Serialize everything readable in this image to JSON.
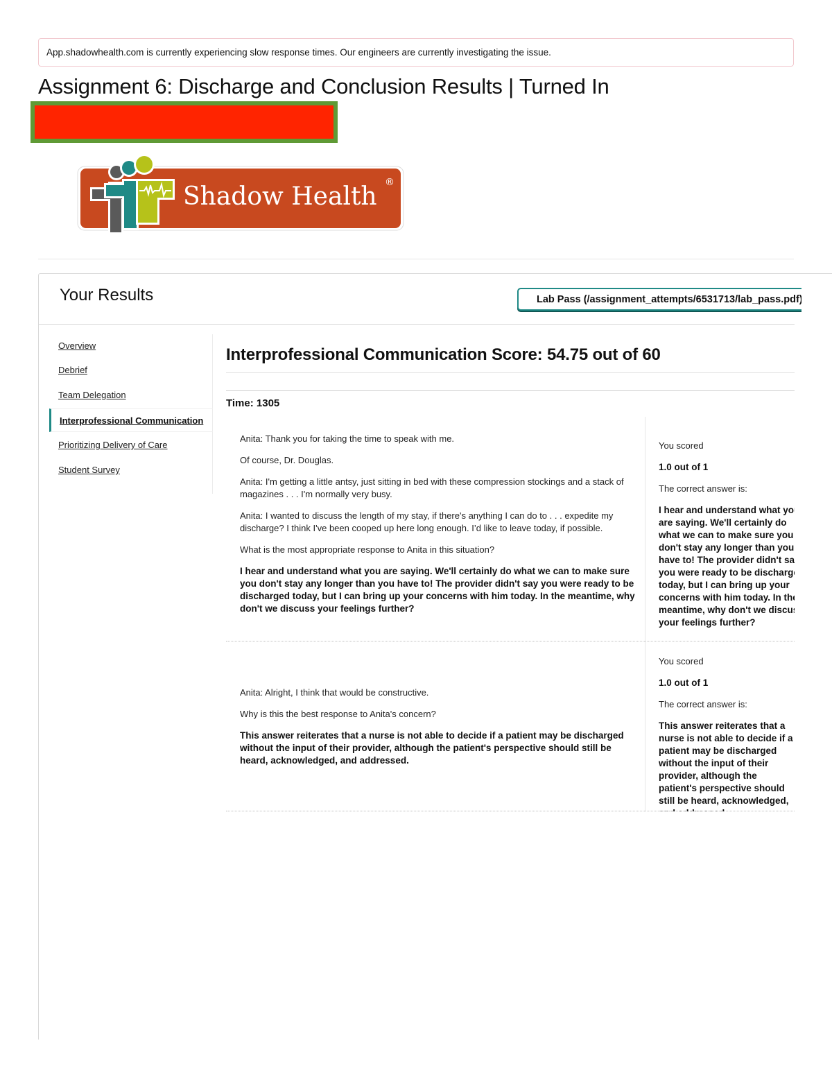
{
  "alert": {
    "message": "App.shadowhealth.com is currently experiencing slow response times. Our engineers are currently investigating the issue."
  },
  "page": {
    "title": "Assignment 6: Discharge and Conclusion Results | Turned In"
  },
  "logo": {
    "text": "Shadow Health",
    "registered": "®",
    "colors": {
      "banner": "#c8491f",
      "teal": "#1f8a86",
      "lime": "#b6c21a",
      "gray": "#5a5a5a"
    }
  },
  "results": {
    "title": "Your Results",
    "lab_pass_label": "Lab Pass (/assignment_attempts/6531713/lab_pass.pdf)"
  },
  "sidebar": {
    "items": [
      {
        "label": "Overview",
        "active": false
      },
      {
        "label": "Debrief",
        "active": false
      },
      {
        "label": "Team Delegation",
        "active": false
      },
      {
        "label": "Interprofessional Communication",
        "active": true
      },
      {
        "label": "Prioritizing Delivery of Care",
        "active": false
      },
      {
        "label": "Student Survey",
        "active": false
      }
    ]
  },
  "main": {
    "score_heading": "Interprofessional Communication Score: 54.75 out of 60",
    "time_label": "Time: 1305",
    "questions": [
      {
        "dialogue": [
          "Anita: Thank you for taking the time to speak with me.",
          "Of course, Dr. Douglas.",
          "Anita: I'm getting a little antsy, just sitting in bed with these compression stockings and a stack of magazines . . . I'm normally very busy.",
          "Anita: I wanted to discuss the length of my stay, if there's anything I can do to . . . expedite my discharge? I think I've been cooped up here long enough. I’d like to leave today, if possible."
        ],
        "prompt": "What is the most appropriate response to Anita in this situation?",
        "answer": "I hear and understand what you are saying. We'll certainly do what we can to make sure you don't stay any longer than you have to! The provider didn't say you were ready to be discharged today, but I can bring up your concerns with him today. In the meantime, why don't we discuss your feelings further?",
        "you_scored_label": "You scored",
        "score": "1.0 out of 1",
        "correct_label": "The correct answer is:",
        "correct_answer": "I hear and understand what you are saying. We'll certainly do what we can to make sure you don't stay any longer than you have to! The provider didn't say you were ready to be discharged today, but I can bring up your concerns with him today. In the meantime, why don't we discuss your feelings further?"
      },
      {
        "dialogue": [
          "Anita: Alright, I think that would be constructive."
        ],
        "prompt": "Why is this the best response to Anita's concern?",
        "answer": "This answer reiterates that a nurse is not able to decide if a patient may be discharged without the input of their provider, although the patient's perspective should still be heard, acknowledged, and addressed.",
        "you_scored_label": "You scored",
        "score": "1.0 out of 1",
        "correct_label": "The correct answer is:",
        "correct_answer": "This answer reiterates that a nurse is not able to decide if a patient may be discharged without the input of their provider, although the patient's perspective should still be heard, acknowledged, and addressed."
      }
    ]
  }
}
